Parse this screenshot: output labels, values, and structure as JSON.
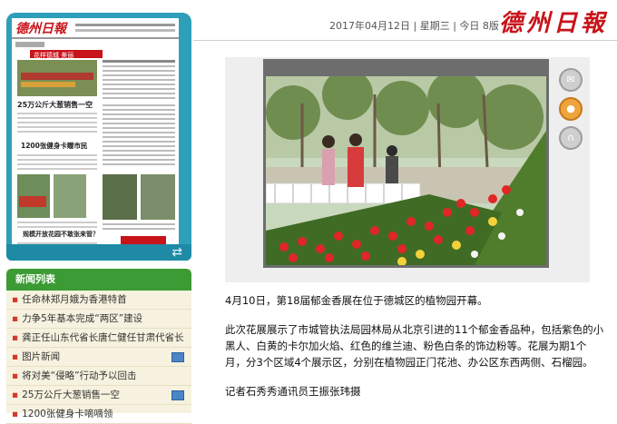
{
  "header": {
    "date": "2017年04月12日",
    "weekday": "星期三",
    "edition": "今日 8版",
    "logo": "德州日報"
  },
  "thumbnail": {
    "masthead": "德州日報",
    "headline_1": "25万公斤大葱销售一空",
    "headline_2": "1200张健身卡赠市民",
    "headline_3": "规模开放花园不敢张来管？",
    "section_title": "花样德城 美丽"
  },
  "news_list": {
    "title": "新闻列表",
    "items": [
      {
        "label": "任命林郑月娥为香港特首",
        "photo": false
      },
      {
        "label": "力争5年基本完成“两区”建设",
        "photo": false
      },
      {
        "label": "龚正任山东代省长唐仁健任甘肃代省长",
        "photo": false
      },
      {
        "label": "图片新闻",
        "photo": true
      },
      {
        "label": "将对美“侵略”行动予以回击",
        "photo": false
      },
      {
        "label": "25万公斤大葱销售一空",
        "photo": true
      },
      {
        "label": "1200张健身卡嘀嘀领",
        "photo": false
      }
    ]
  },
  "article": {
    "para1": "4月10日，第18届郁金香展在位于德城区的植物园开幕。",
    "para2": "此次花展展示了市城管执法局园林局从北京引进的11个郁金香品种，包括紫色的小黑人、白黄的卡尔加火焰、红色的维兰迪、粉色白条的饰边粉等。花展为期1个月，分3个区域4个展示区，分别在植物园正门花池、办公区东西两侧、石榴园。",
    "byline": "记者石秀秀通讯员王振张玮摄"
  },
  "icons": {
    "swap": "swap-arrows-icon",
    "buttons": [
      "speech-icon",
      "person-icon",
      "headphones-icon"
    ]
  },
  "colors": {
    "accent_blue": "#2e9fb9",
    "accent_green": "#3c9b34",
    "logo_red": "#c8131a"
  }
}
